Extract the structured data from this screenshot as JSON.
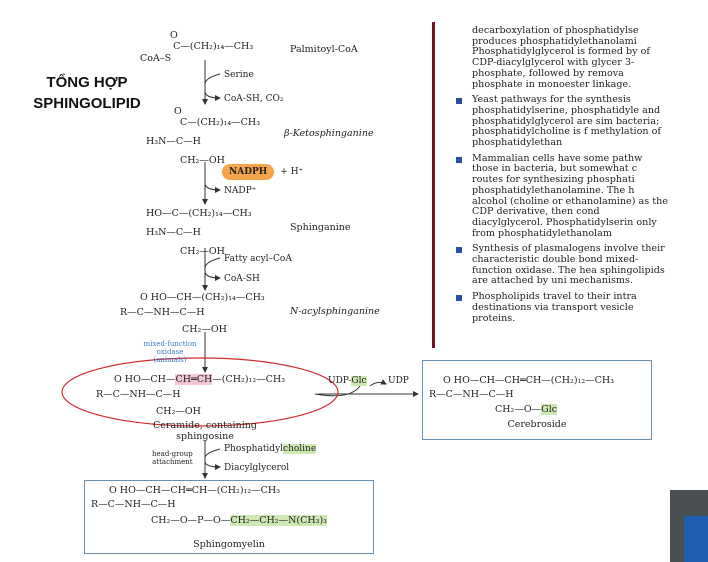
{
  "slide": {
    "title_line1": "TỔNG HỢP",
    "title_line2": "SPHINGOLIPID"
  },
  "pathway": {
    "palmitoyl_coa": {
      "struct_top": "O",
      "struct_main": "C—(CH₂)₁₄—CH₃",
      "struct_left": "CoA–S",
      "name": "Palmitoyl-CoA"
    },
    "step1": {
      "in": "Serine",
      "out": "CoA-SH, CO₂"
    },
    "ketosphinganine": {
      "line1": "O",
      "line2": "C—(CH₂)₁₄—CH₃",
      "line3": "H₃N—C—H",
      "line4": "CH₂—OH",
      "name": "β-Ketosphinganine"
    },
    "step2": {
      "in": "NADPH",
      "in_extra": "+ H⁺",
      "out": "NADP⁺"
    },
    "sphinganine": {
      "line1": "HO—C—(CH₂)₁₄—CH₃",
      "line2": "H₃N—C—H",
      "line3": "CH₂—OH",
      "name": "Sphinganine"
    },
    "step3": {
      "in": "Fatty acyl–CoA",
      "out": "CoA-SH"
    },
    "acylsphinganine": {
      "line1": "O    HO—CH—(CH₂)₁₄—CH₃",
      "line2": "R—C—NH—C—H",
      "line3": "CH₂—OH",
      "name": "N-acylsphinganine"
    },
    "step4": {
      "enzyme": "mixed-function oxidase (animals)"
    },
    "ceramide": {
      "line1_a": "O    HO—CH—",
      "line1_hl": "CH═CH",
      "line1_b": "—(CH₂)₁₂—CH₃",
      "line2": "R—C—NH—C—H",
      "line3": "CH₂—OH",
      "name_line1": "Ceramide, containing",
      "name_line2": "sphingosine"
    },
    "to_cerebroside": {
      "in_a": "UDP-",
      "in_hl": "Glc",
      "out": "UDP"
    },
    "cerebroside": {
      "line1": "O    HO—CH—CH═CH—(CH₂)₁₂—CH₃",
      "line2": "R—C—NH—C—H",
      "line3_a": "CH₂—O—",
      "line3_hl": "Glc",
      "name": "Cerebroside"
    },
    "step5": {
      "label_line1": "head-group",
      "label_line2": "attachment",
      "in_a": "Phosphatidyl",
      "in_hl": "choline",
      "out": "Diacylglycerol"
    },
    "sphingomyelin": {
      "line1": "O    HO—CH—CH═CH—(CH₂)₁₂—CH₃",
      "line2": "R—C—NH—C—H",
      "line3_a": "CH₂—O—P—O—",
      "line3_hl": "CH₂—CH₂—N(CH₃)₃",
      "name": "Sphingomyelin"
    }
  },
  "summary": {
    "intro": "decarboxylation of phosphatidylse produces phosphatidylethanolami Phosphatidylglycerol is formed by of CDP-diacylglycerol with glycer 3-phosphate, followed by remova phosphate in monoester linkage.",
    "bullets": [
      "Yeast pathways for the synthesis phosphatidylserine, phosphatidyle and phosphatidylglycerol are sim bacteria; phosphatidylcholine is f methylation of phosphatidylethan",
      "Mammalian cells have some pathw those in bacteria, but somewhat c routes for synthesizing phosphati phosphatidylethanolamine. The h alcohol (choline or ethanolamine) as the CDP derivative, then cond diacylglycerol. Phosphatidylserin only from phosphatidylethanolam",
      "Synthesis of plasmalogens involve their characteristic double bond mixed-function oxidase. The hea sphingolipids are attached by uni mechanisms.",
      "Phospholipids travel to their intra destinations via transport vesicle proteins."
    ]
  },
  "colors": {
    "highlight_green": "#cde8b0",
    "highlight_pink": "#f4c6d4",
    "nadph_orange": "#f4a54c",
    "circle_red": "#d42a2a",
    "divider_maroon": "#7a1420",
    "bullet_blue": "#2a4fa0",
    "enzyme_blue": "#3a7cc7"
  }
}
